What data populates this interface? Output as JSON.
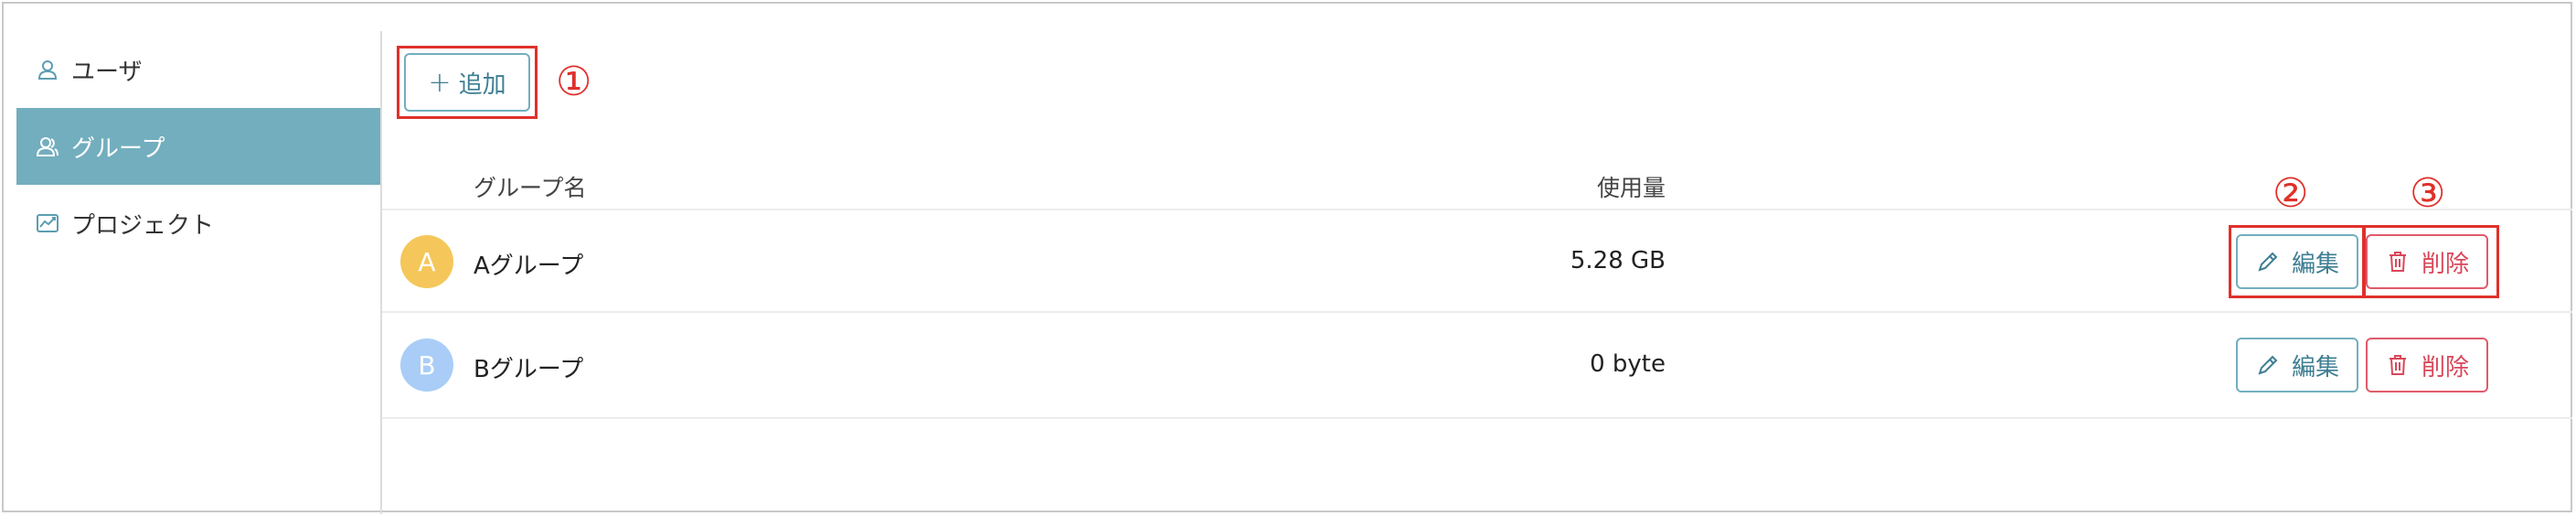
{
  "sidebar": {
    "items": [
      {
        "label": "ユーザ",
        "icon": "user-icon",
        "active": false
      },
      {
        "label": "グループ",
        "icon": "group-icon",
        "active": true
      },
      {
        "label": "プロジェクト",
        "icon": "project-icon",
        "active": false
      }
    ]
  },
  "toolbar": {
    "add_label": "追加",
    "add_icon": "plus-icon"
  },
  "table": {
    "headers": {
      "name": "グループ名",
      "usage": "使用量"
    },
    "rows": [
      {
        "avatar": "A",
        "avatar_color": "#f5c75a",
        "name": "Aグループ",
        "usage": "5.28 GB",
        "edit_label": "編集",
        "delete_label": "削除"
      },
      {
        "avatar": "B",
        "avatar_color": "#a9cdf7",
        "name": "Bグループ",
        "usage": "0 byte",
        "edit_label": "編集",
        "delete_label": "削除"
      }
    ]
  },
  "annotations": {
    "one": "①",
    "two": "②",
    "three": "③"
  },
  "colors": {
    "accent": "#73aebe",
    "danger": "#e05a6a",
    "annotation": "#e0302a"
  }
}
